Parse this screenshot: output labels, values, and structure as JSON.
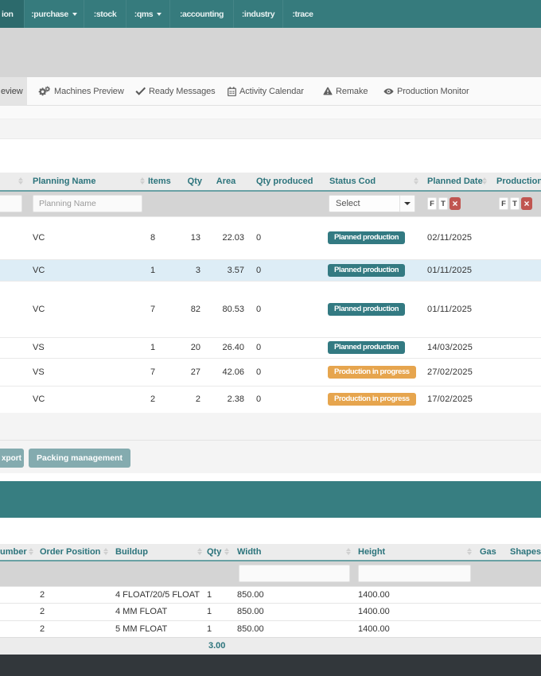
{
  "nav": {
    "items": [
      {
        "label": "ion",
        "active": true,
        "has_caret": false
      },
      {
        "label": ":purchase",
        "active": false,
        "has_caret": true
      },
      {
        "label": ":stock",
        "active": false,
        "has_caret": false
      },
      {
        "label": ":qms",
        "active": false,
        "has_caret": true
      },
      {
        "label": ":accounting",
        "active": false,
        "has_caret": false
      },
      {
        "label": ":industry",
        "active": false,
        "has_caret": false
      },
      {
        "label": ":trace",
        "active": false,
        "has_caret": false
      }
    ]
  },
  "tabs": {
    "items": [
      {
        "label": "eview",
        "active": true,
        "icon": null
      },
      {
        "label": "Machines Preview",
        "active": false,
        "icon": "cogs-icon"
      },
      {
        "label": "Ready Messages",
        "active": false,
        "icon": "check-icon"
      },
      {
        "label": "Activity Calendar",
        "active": false,
        "icon": "calendar-icon"
      },
      {
        "label": "Remake",
        "active": false,
        "icon": "warning-icon"
      },
      {
        "label": "Production Monitor",
        "active": false,
        "icon": "eye-icon"
      }
    ]
  },
  "planning_table": {
    "columns": {
      "planning_name": "Planning Name",
      "items": "Items",
      "qty": "Qty",
      "area": "Area",
      "qty_produced": "Qty produced",
      "status": "Status Cod",
      "planned_date": "Planned Date",
      "production": "Production"
    },
    "filters": {
      "planning_name_placeholder": "Planning Name",
      "status_select": "Select",
      "from": "F",
      "to": "T",
      "clear": "x"
    },
    "rows": [
      {
        "planning_name": "VC",
        "items": "8",
        "qty": "13",
        "area": "22.03",
        "qty_produced": "0",
        "status": "Planned production",
        "status_type": "planned",
        "planned_date": "02/11/2025"
      },
      {
        "planning_name": "VC",
        "items": "1",
        "qty": "3",
        "area": "3.57",
        "qty_produced": "0",
        "status": "Planned production",
        "status_type": "planned",
        "planned_date": "01/11/2025"
      },
      {
        "planning_name": "VC",
        "items": "7",
        "qty": "82",
        "area": "80.53",
        "qty_produced": "0",
        "status": "Planned production",
        "status_type": "planned",
        "planned_date": "01/11/2025"
      },
      {
        "planning_name": "VS",
        "items": "1",
        "qty": "20",
        "area": "26.40",
        "qty_produced": "0",
        "status": "Planned production",
        "status_type": "planned",
        "planned_date": "14/03/2025"
      },
      {
        "planning_name": "VS",
        "items": "7",
        "qty": "27",
        "area": "42.06",
        "qty_produced": "0",
        "status": "Production in progress",
        "status_type": "in-progress",
        "planned_date": "27/02/2025"
      },
      {
        "planning_name": "VC",
        "items": "2",
        "qty": "2",
        "area": "2.38",
        "qty_produced": "0",
        "status": "Production in progress",
        "status_type": "in-progress",
        "planned_date": "17/02/2025"
      }
    ],
    "actions": {
      "export_label": "xport",
      "packing_label": "Packing management"
    }
  },
  "glass_table": {
    "columns": {
      "number": "umber",
      "order_position": "Order Position",
      "buildup": "Buildup",
      "qty": "Qty",
      "width": "Width",
      "height": "Height",
      "gas": "Gas",
      "shapes": "Shapes"
    },
    "rows": [
      {
        "order_position": "2",
        "buildup": "4 FLOAT/20/5 FLOAT",
        "qty": "1",
        "width": "850.00",
        "height": "1400.00"
      },
      {
        "order_position": "2",
        "buildup": "4 MM FLOAT",
        "qty": "1",
        "width": "850.00",
        "height": "1400.00"
      },
      {
        "order_position": "2",
        "buildup": "5 MM FLOAT",
        "qty": "1",
        "width": "850.00",
        "height": "1400.00"
      }
    ],
    "footer": {
      "qty_total": "3.00"
    }
  },
  "colors": {
    "nav_teal": "#367b7d",
    "nav_active_teal": "#2c6a6c",
    "badge_teal": "#337a82",
    "badge_orange": "#e6a54e",
    "button_teal": "#84abaf",
    "danger_red": "#c05550",
    "highlight_row": "#ddedf6",
    "band_teal": "#377e81",
    "header_text_teal": "#2b737b"
  }
}
